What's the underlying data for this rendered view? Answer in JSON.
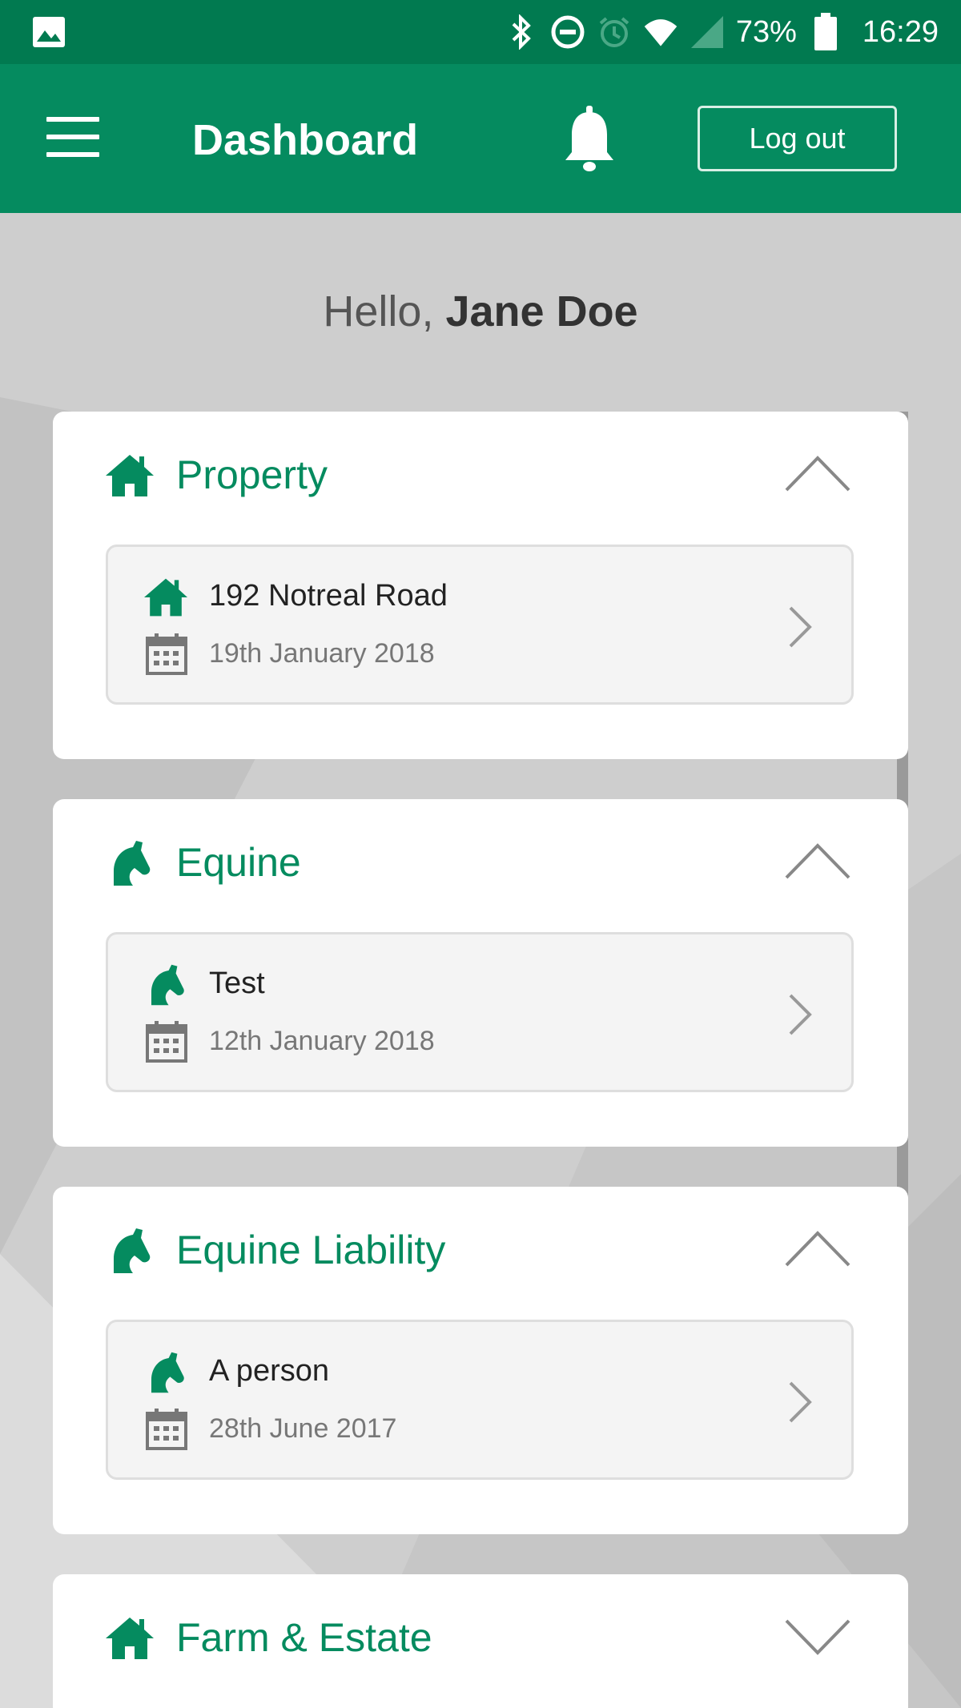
{
  "status_bar": {
    "battery_percent": "73%",
    "time": "16:29",
    "icons": [
      "image-icon",
      "bluetooth-icon",
      "do-not-disturb-icon",
      "alarm-icon",
      "wifi-icon",
      "cellular-icon",
      "battery-icon"
    ]
  },
  "app_bar": {
    "title": "Dashboard",
    "logout_label": "Log out",
    "menu_icon": "hamburger-menu-icon",
    "notification_icon": "bell-icon"
  },
  "greeting": {
    "prefix": "Hello,",
    "name": "Jane Doe"
  },
  "sections": [
    {
      "title": "Property",
      "icon": "house-icon",
      "expanded": true,
      "items": [
        {
          "title": "192 Notreal Road",
          "date": "19th January 2018",
          "icon": "house-icon"
        }
      ]
    },
    {
      "title": "Equine",
      "icon": "horse-icon",
      "expanded": true,
      "items": [
        {
          "title": "Test",
          "date": "12th January 2018",
          "icon": "horse-icon"
        }
      ]
    },
    {
      "title": "Equine Liability",
      "icon": "horse-icon",
      "expanded": true,
      "items": [
        {
          "title": "A person",
          "date": "28th June 2017",
          "icon": "horse-icon"
        }
      ]
    },
    {
      "title": "Farm & Estate",
      "icon": "house-icon",
      "expanded": false,
      "items": []
    }
  ],
  "colors": {
    "brand_green": "#058b5f",
    "status_bar_green": "#017a50",
    "background_grey": "#cfcfcf"
  }
}
